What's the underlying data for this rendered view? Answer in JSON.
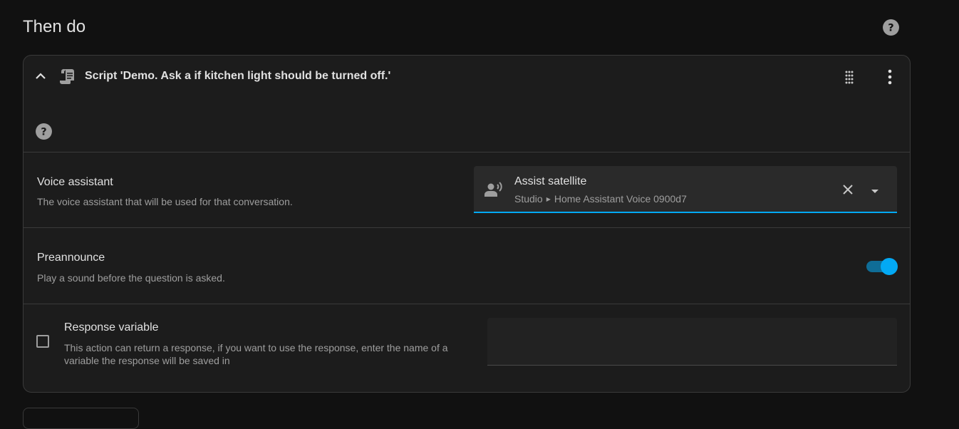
{
  "section": {
    "title": "Then do"
  },
  "card": {
    "title": "Script 'Demo. Ask a if kitchen light should be turned off.'",
    "voice_assistant": {
      "label": "Voice assistant",
      "description": "The voice assistant that will be used for that conversation.",
      "value_title": "Assist satellite",
      "value_area": "Studio",
      "value_device": "Home Assistant Voice 0900d7",
      "separator": "▶"
    },
    "preannounce": {
      "label": "Preannounce",
      "description": "Play a sound before the question is asked.",
      "enabled": true
    },
    "response_variable": {
      "label": "Response variable",
      "description": "This action can return a response, if you want to use the response, enter the name of a variable the response will be saved in",
      "checked": false,
      "value": ""
    }
  },
  "colors": {
    "accent": "#03a9f4",
    "background": "#111111",
    "card": "#1c1c1c"
  }
}
